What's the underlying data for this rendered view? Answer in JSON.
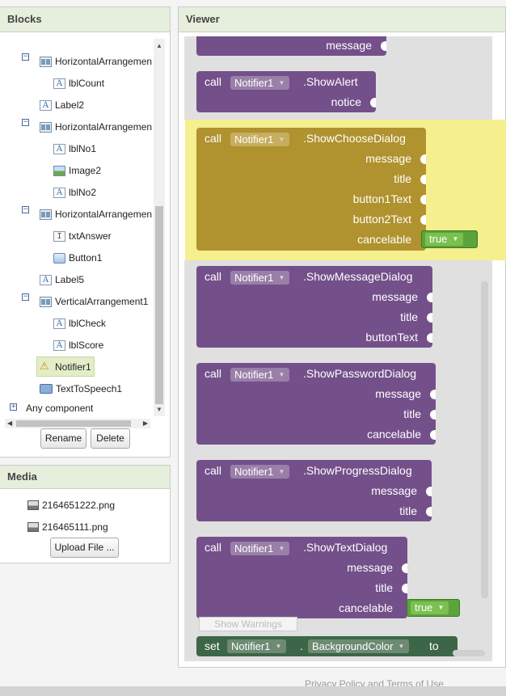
{
  "blocks_panel": {
    "title": "Blocks",
    "tree": [
      {
        "label": "HorizontalArrangemen",
        "icon": "arrangement-icon"
      },
      {
        "label": "lblCount",
        "icon": "label-icon"
      },
      {
        "label": "Label2",
        "icon": "label-icon"
      },
      {
        "label": "HorizontalArrangemen",
        "icon": "arrangement-icon"
      },
      {
        "label": "lblNo1",
        "icon": "label-icon"
      },
      {
        "label": "Image2",
        "icon": "image-icon"
      },
      {
        "label": "lblNo2",
        "icon": "label-icon"
      },
      {
        "label": "HorizontalArrangemen",
        "icon": "arrangement-icon"
      },
      {
        "label": "txtAnswer",
        "icon": "textbox-icon"
      },
      {
        "label": "Button1",
        "icon": "button-icon"
      },
      {
        "label": "Label5",
        "icon": "label-icon"
      },
      {
        "label": "VerticalArrangement1",
        "icon": "arrangement-icon"
      },
      {
        "label": "lblCheck",
        "icon": "label-icon"
      },
      {
        "label": "lblScore",
        "icon": "label-icon"
      },
      {
        "label": "Notifier1",
        "icon": "warning-icon",
        "selected": true
      },
      {
        "label": "TextToSpeech1",
        "icon": "speech-icon"
      },
      {
        "label": "Any component",
        "icon": "expand-icon"
      }
    ],
    "rename_label": "Rename",
    "delete_label": "Delete"
  },
  "media_panel": {
    "title": "Media",
    "files": [
      "2164651222.png",
      "216465111.png"
    ],
    "upload_label": "Upload File ..."
  },
  "viewer": {
    "title": "Viewer",
    "blocks": {
      "partial_top": {
        "params": [
          "message"
        ]
      },
      "show_alert": {
        "call": "call",
        "component": "Notifier1",
        "method": ".ShowAlert",
        "params": [
          "notice"
        ]
      },
      "show_choose_dialog": {
        "call": "call",
        "component": "Notifier1",
        "method": ".ShowChooseDialog",
        "params": [
          "message",
          "title",
          "button1Text",
          "button2Text",
          "cancelable"
        ],
        "cancelable_value": "true"
      },
      "show_message_dialog": {
        "call": "call",
        "component": "Notifier1",
        "method": ".ShowMessageDialog",
        "params": [
          "message",
          "title",
          "buttonText"
        ]
      },
      "show_password_dialog": {
        "call": "call",
        "component": "Notifier1",
        "method": ".ShowPasswordDialog",
        "params": [
          "message",
          "title",
          "cancelable"
        ]
      },
      "show_progress_dialog": {
        "call": "call",
        "component": "Notifier1",
        "method": ".ShowProgressDialog",
        "params": [
          "message",
          "title"
        ]
      },
      "show_text_dialog": {
        "call": "call",
        "component": "Notifier1",
        "method": ".ShowTextDialog",
        "params": [
          "message",
          "title",
          "cancelable"
        ],
        "cancelable_value": "true"
      },
      "set_background": {
        "set": "set",
        "component": "Notifier1",
        "dot": ".",
        "property": "BackgroundColor",
        "to": "to"
      }
    },
    "show_warnings_label": "Show Warnings"
  },
  "footer": {
    "text": "Privacy Policy and Terms of Use"
  },
  "colors": {
    "procedure_block": "#74508a",
    "highlighted_block": "#b0922e",
    "setter_block": "#3d6648",
    "boolean_block": "#5ba33b",
    "highlight": "#f5ef8e"
  }
}
